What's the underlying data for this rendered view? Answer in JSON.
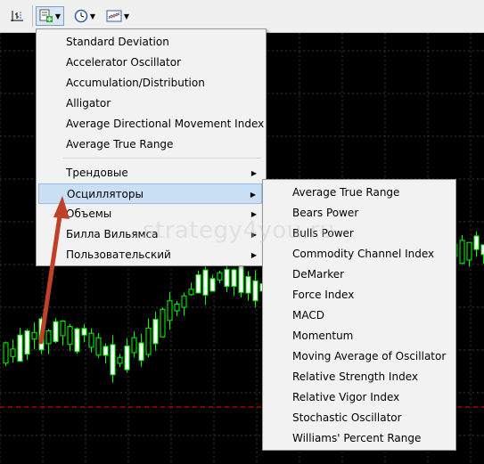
{
  "toolbar": {
    "buttons": [
      {
        "name": "period-separator-icon"
      },
      {
        "name": "indicator-list-icon"
      },
      {
        "name": "clock-icon"
      },
      {
        "name": "template-icon"
      }
    ]
  },
  "main_menu": {
    "items": [
      {
        "label": "Standard Deviation",
        "submenu": false
      },
      {
        "label": "Accelerator Oscillator",
        "submenu": false
      },
      {
        "label": "Accumulation/Distribution",
        "submenu": false
      },
      {
        "label": "Alligator",
        "submenu": false
      },
      {
        "label": "Average Directional Movement Index",
        "submenu": false
      },
      {
        "label": "Average True Range",
        "submenu": false
      },
      {
        "label": "Трендовые",
        "submenu": true
      },
      {
        "label": "Осцилляторы",
        "submenu": true,
        "highlighted": true
      },
      {
        "label": "Объемы",
        "submenu": true
      },
      {
        "label": "Билла Вильямса",
        "submenu": true
      },
      {
        "label": "Пользовательский",
        "submenu": true
      }
    ]
  },
  "oscillators_submenu": {
    "items": [
      "Average True Range",
      "Bears Power",
      "Bulls Power",
      "Commodity Channel Index",
      "DeMarker",
      "Force Index",
      "MACD",
      "Momentum",
      "Moving Average of Oscillator",
      "Relative Strength Index",
      "Relative Vigor Index",
      "Stochastic Oscillator",
      "Williams' Percent Range"
    ]
  },
  "watermark": "strategy4you.ru",
  "colors": {
    "candle_bull": "#00ff00",
    "candle_body_bull": "#ffffff",
    "grid": "#3a3a3a",
    "price_line": "#ff0000",
    "arrow": "#c0402a",
    "menu_highlight": "#c9dff3"
  }
}
